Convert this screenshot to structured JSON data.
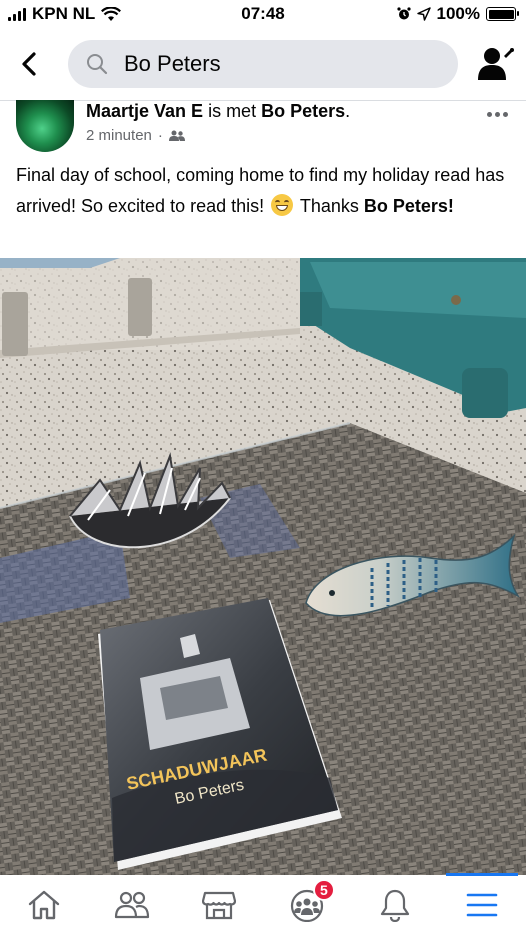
{
  "status_bar": {
    "carrier": "KPN NL",
    "time": "07:48",
    "battery": "100%",
    "battery_level": 1.0
  },
  "search": {
    "query": "Bo Peters"
  },
  "post": {
    "author": "Maartje Van E",
    "with_text": " is met ",
    "tagged": "Bo Peters",
    "period": ".",
    "timestamp": "2 minuten",
    "meta_separator": "·",
    "audience_icon": "friends-icon",
    "text": "Final day of school, coming home to find my holiday read has arrived! So excited to read this!",
    "emoji": "grinning-face",
    "thanks": "Thanks",
    "thanks_name": "Bo Peters",
    "thanks_end": "!"
  },
  "photo": {
    "book_title": "SCHADUWJAAR",
    "book_author": "Bo Peters"
  },
  "bottom_nav": {
    "items": [
      {
        "icon": "home-icon"
      },
      {
        "icon": "friends-icon"
      },
      {
        "icon": "marketplace-icon"
      },
      {
        "icon": "groups-icon",
        "badge": "5"
      },
      {
        "icon": "bell-icon"
      },
      {
        "icon": "menu-icon",
        "active": true
      }
    ]
  },
  "colors": {
    "accent": "#1877f2",
    "badge": "#e41e3f",
    "search_bg": "#e4e6eb",
    "meta_text": "#65676b"
  }
}
